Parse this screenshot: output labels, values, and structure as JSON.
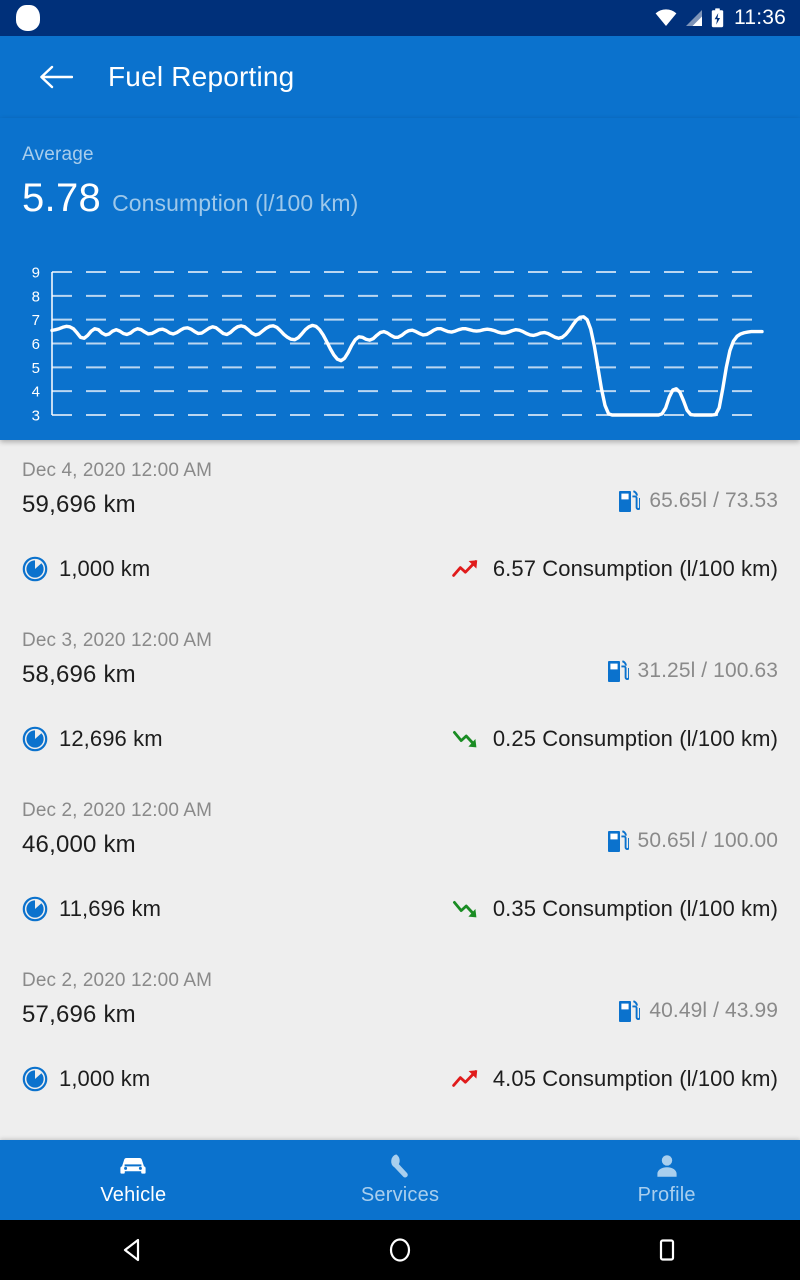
{
  "status_bar": {
    "time": "11:36",
    "icons": [
      "wifi-icon",
      "cell-signal-icon",
      "battery-charging-icon"
    ]
  },
  "app_bar": {
    "back_icon": "back-arrow-icon",
    "title": "Fuel Reporting"
  },
  "summary": {
    "label": "Average",
    "value": "5.78",
    "unit": "Consumption (l/100 km)"
  },
  "colors": {
    "brand_blue": "#0b72cd",
    "status_bar_blue": "#00307a",
    "list_bg": "#eeeeee",
    "trend_up": "#e01b1b",
    "trend_down": "#1a8c23",
    "icon_blue": "#0b72cd"
  },
  "chart_data": {
    "type": "line",
    "title": "",
    "xlabel": "",
    "ylabel": "Consumption (l/100 km)",
    "ylim": [
      3,
      9
    ],
    "yticks": [
      9,
      8,
      7,
      6,
      5,
      4,
      3
    ],
    "grid": "dashed-horizontal",
    "legend": "none",
    "series": [
      {
        "name": "Consumption (l/100 km)",
        "values": [
          6.55,
          6.58,
          6.62,
          6.68,
          6.72,
          6.7,
          6.62,
          6.45,
          6.26,
          6.22,
          6.34,
          6.52,
          6.62,
          6.58,
          6.44,
          6.36,
          6.4,
          6.52,
          6.58,
          6.52,
          6.42,
          6.38,
          6.44,
          6.56,
          6.62,
          6.58,
          6.48,
          6.4,
          6.42,
          6.5,
          6.58,
          6.6,
          6.54,
          6.44,
          6.4,
          6.46,
          6.56,
          6.64,
          6.66,
          6.6,
          6.5,
          6.42,
          6.44,
          6.54,
          6.64,
          6.7,
          6.66,
          6.54,
          6.42,
          6.38,
          6.46,
          6.6,
          6.7,
          6.74,
          6.7,
          6.58,
          6.44,
          6.36,
          6.4,
          6.52,
          6.64,
          6.72,
          6.74,
          6.68,
          6.54,
          6.38,
          6.26,
          6.18,
          6.16,
          6.24,
          6.4,
          6.58,
          6.7,
          6.76,
          6.72,
          6.58,
          6.36,
          6.08,
          5.78,
          5.52,
          5.34,
          5.28,
          5.38,
          5.62,
          5.92,
          6.16,
          6.28,
          6.26,
          6.18,
          6.14,
          6.2,
          6.34,
          6.46,
          6.5,
          6.44,
          6.34,
          6.26,
          6.26,
          6.34,
          6.46,
          6.54,
          6.56,
          6.5,
          6.42,
          6.36,
          6.38,
          6.46,
          6.56,
          6.62,
          6.62,
          6.56,
          6.5,
          6.48,
          6.52,
          6.58,
          6.62,
          6.62,
          6.58,
          6.54,
          6.52,
          6.54,
          6.58,
          6.6,
          6.58,
          6.54,
          6.48,
          6.44,
          6.44,
          6.48,
          6.54,
          6.58,
          6.56,
          6.5,
          6.42,
          6.36,
          6.34,
          6.38,
          6.44,
          6.46,
          6.42,
          6.34,
          6.26,
          6.22,
          6.26,
          6.38,
          6.56,
          6.78,
          6.98,
          7.1,
          7.12,
          7.0,
          6.6,
          5.9,
          5.0,
          4.1,
          3.4,
          3.05,
          3.0,
          3.0,
          3.0,
          3.0,
          3.0,
          3.0,
          3.0,
          3.0,
          3.0,
          3.0,
          3.0,
          3.0,
          3.0,
          3.0,
          3.05,
          3.3,
          3.75,
          4.05,
          4.1,
          3.95,
          3.6,
          3.2,
          3.02,
          3.0,
          3.0,
          3.0,
          3.0,
          3.0,
          3.0,
          3.02,
          3.3,
          4.1,
          5.0,
          5.7,
          6.1,
          6.3,
          6.4,
          6.45,
          6.48,
          6.5,
          6.5,
          6.5,
          6.5
        ]
      }
    ]
  },
  "entries": [
    {
      "date": "Dec 4, 2020 12:00 AM",
      "odometer": "59,696 km",
      "fuel_icon": "fuel-pump-icon",
      "fuel": "65.65l / 73.53",
      "distance_icon": "odometer-gauge-icon",
      "distance": "1,000 km",
      "trend_icon": "trend-up-icon",
      "trend_direction": "up",
      "consumption": "6.57 Consumption (l/100 km)"
    },
    {
      "date": "Dec 3, 2020 12:00 AM",
      "odometer": "58,696 km",
      "fuel_icon": "fuel-pump-icon",
      "fuel": "31.25l / 100.63",
      "distance_icon": "odometer-gauge-icon",
      "distance": "12,696 km",
      "trend_icon": "trend-down-icon",
      "trend_direction": "down",
      "consumption": "0.25 Consumption (l/100 km)"
    },
    {
      "date": "Dec 2, 2020 12:00 AM",
      "odometer": "46,000 km",
      "fuel_icon": "fuel-pump-icon",
      "fuel": "50.65l / 100.00",
      "distance_icon": "odometer-gauge-icon",
      "distance": "11,696 km",
      "trend_icon": "trend-down-icon",
      "trend_direction": "down",
      "consumption": "0.35 Consumption (l/100 km)"
    },
    {
      "date": "Dec 2, 2020 12:00 AM",
      "odometer": "57,696 km",
      "fuel_icon": "fuel-pump-icon",
      "fuel": "40.49l / 43.99",
      "distance_icon": "odometer-gauge-icon",
      "distance": "1,000 km",
      "trend_icon": "trend-up-icon",
      "trend_direction": "up",
      "consumption": "4.05 Consumption (l/100 km)"
    }
  ],
  "bottom_nav": [
    {
      "label": "Vehicle",
      "icon": "car-icon",
      "active": true
    },
    {
      "label": "Services",
      "icon": "wrench-icon",
      "active": false
    },
    {
      "label": "Profile",
      "icon": "person-icon",
      "active": false
    }
  ],
  "system_nav": {
    "back": "system-back-icon",
    "home": "system-home-icon",
    "recents": "system-recents-icon"
  }
}
